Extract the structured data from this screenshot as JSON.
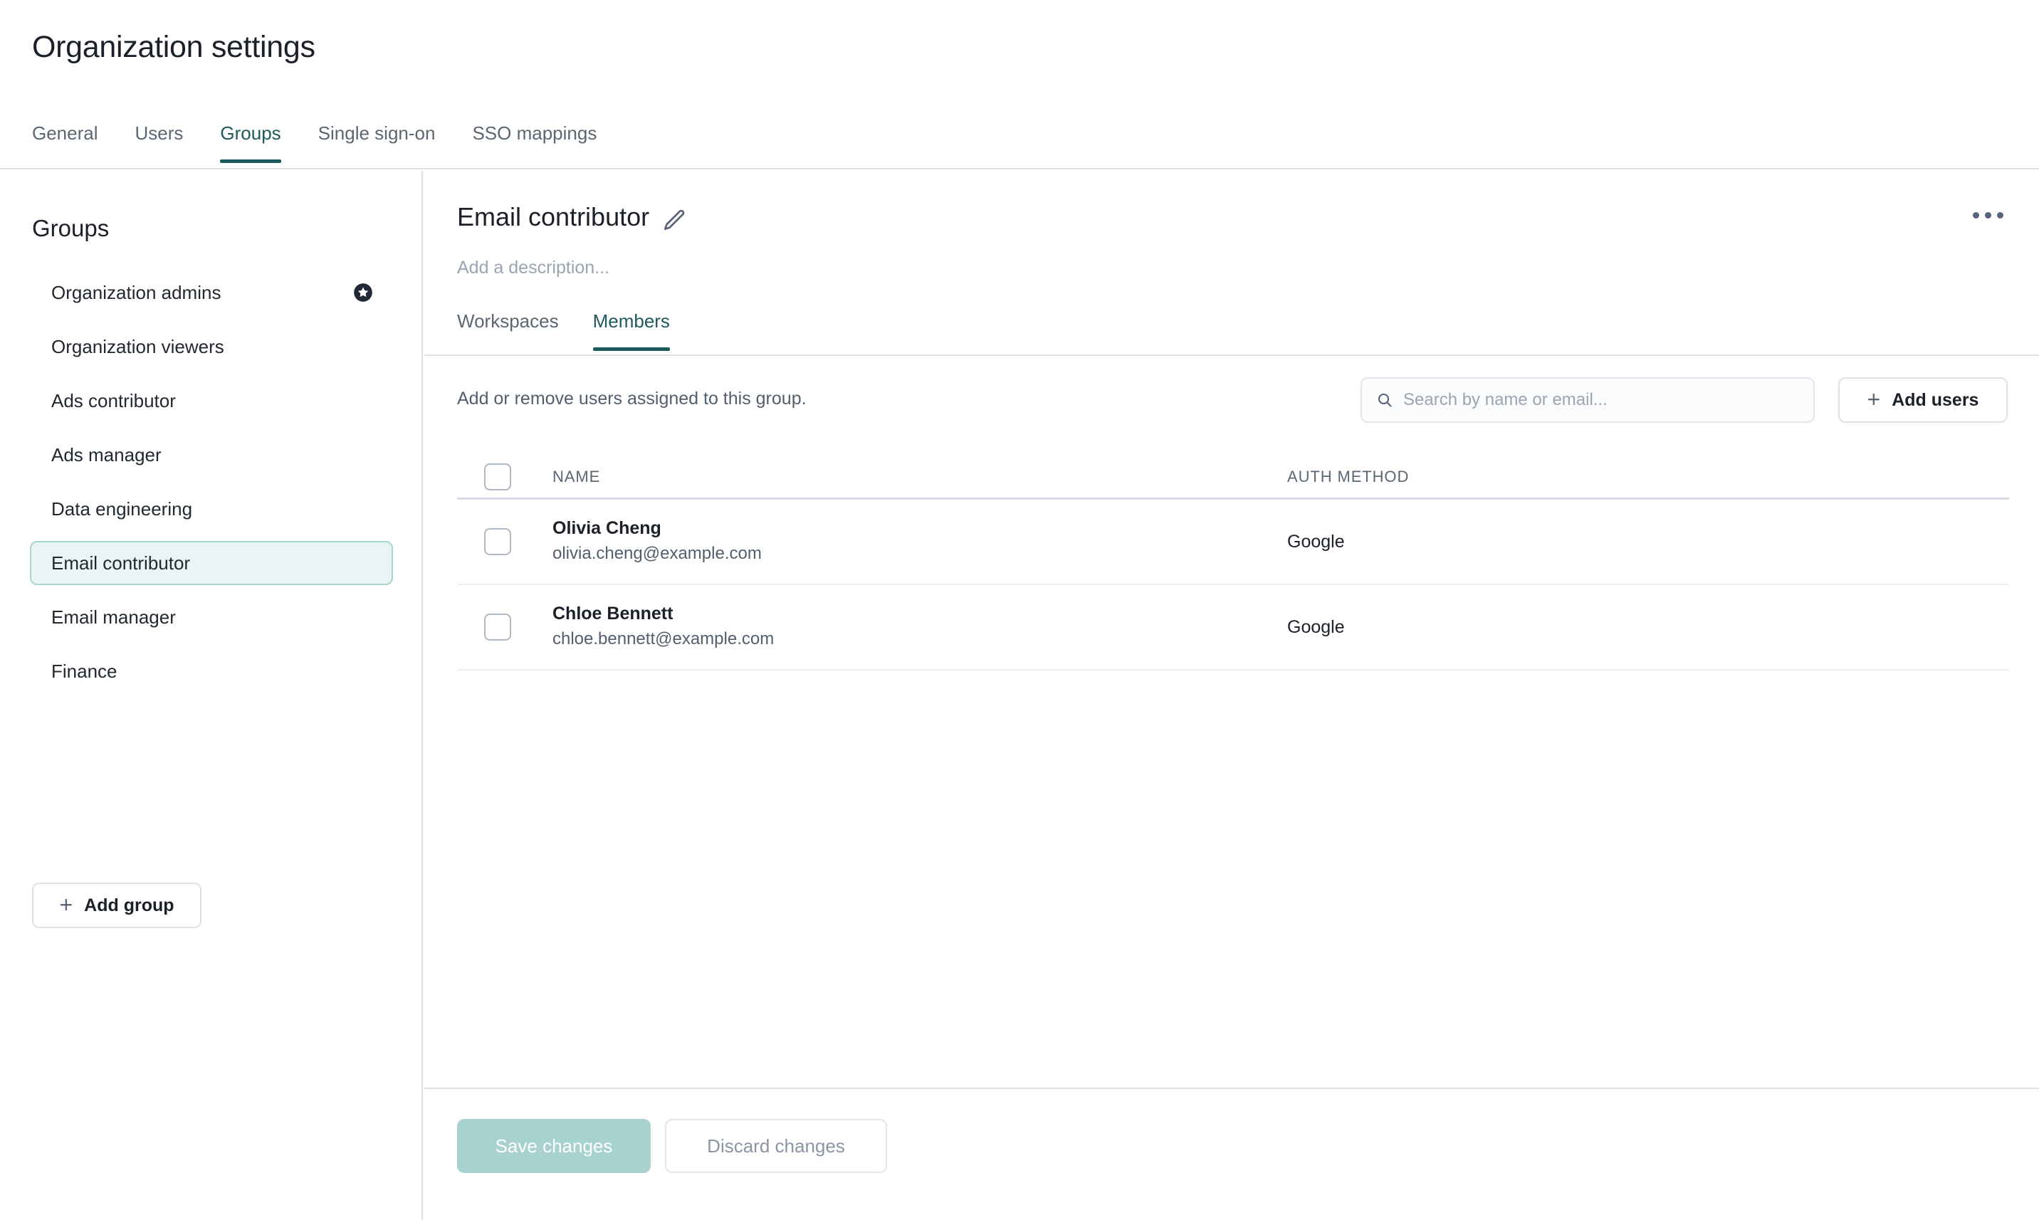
{
  "header": {
    "title": "Organization settings",
    "tabs": [
      {
        "label": "General",
        "active": false
      },
      {
        "label": "Users",
        "active": false
      },
      {
        "label": "Groups",
        "active": true
      },
      {
        "label": "Single sign-on",
        "active": false
      },
      {
        "label": "SSO mappings",
        "active": false
      }
    ]
  },
  "sidebar": {
    "title": "Groups",
    "items": [
      {
        "label": "Organization admins",
        "badge": "star-badge",
        "selected": false
      },
      {
        "label": "Organization viewers",
        "badge": null,
        "selected": false
      },
      {
        "label": "Ads contributor",
        "badge": null,
        "selected": false
      },
      {
        "label": "Ads manager",
        "badge": null,
        "selected": false
      },
      {
        "label": "Data engineering",
        "badge": null,
        "selected": false
      },
      {
        "label": "Email contributor",
        "badge": null,
        "selected": true
      },
      {
        "label": "Email manager",
        "badge": null,
        "selected": false
      },
      {
        "label": "Finance",
        "badge": null,
        "selected": false
      }
    ],
    "add_group_label": "Add group",
    "add_group_icon": "plus-icon"
  },
  "main": {
    "group_title": "Email contributor",
    "edit_icon": "pencil-icon",
    "kebab_icon": "more-horizontal-icon",
    "description_placeholder": "Add a description...",
    "sub_tabs": [
      {
        "label": "Workspaces",
        "active": false
      },
      {
        "label": "Members",
        "active": true
      }
    ],
    "toolbar": {
      "hint": "Add or remove users assigned to this group.",
      "search_placeholder": "Search by name or email...",
      "search_value": "",
      "search_icon": "search-icon",
      "add_users_label": "Add users",
      "add_users_icon": "plus-icon"
    },
    "table": {
      "columns": [
        "NAME",
        "AUTH METHOD"
      ],
      "rows": [
        {
          "name": "Olivia Cheng",
          "email": "olivia.cheng@example.com",
          "auth_method": "Google",
          "checked": false
        },
        {
          "name": "Chloe Bennett",
          "email": "chloe.bennett@example.com",
          "auth_method": "Google",
          "checked": false
        }
      ]
    }
  },
  "footer": {
    "save_label": "Save changes",
    "discard_label": "Discard changes"
  },
  "colors": {
    "accent_teal": "#1e5a5c",
    "selected_bg": "#e9f5f4",
    "selected_border": "#a9d4d1",
    "save_disabled": "#a8d2cf",
    "text_primary": "#1b2029",
    "text_muted": "#5b6674",
    "border": "#dde1e8"
  }
}
